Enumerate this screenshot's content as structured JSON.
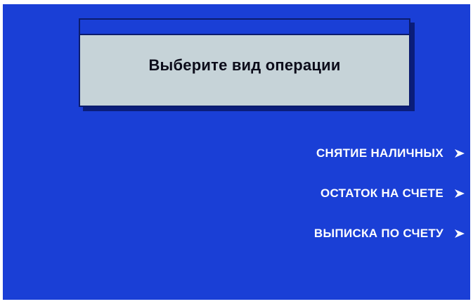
{
  "screen": {
    "prompt": "Выберите вид операции",
    "background_color": "#1a3fd6",
    "prompt_box_color": "#c6d3d8"
  },
  "menu": {
    "items": [
      {
        "label": "СНЯТИЕ НАЛИЧНЫХ",
        "icon": "chevron-right-icon"
      },
      {
        "label": "ОСТАТОК НА СЧЕТЕ",
        "icon": "chevron-right-icon"
      },
      {
        "label": "ВЫПИСКА ПО СЧЕТУ",
        "icon": "chevron-right-icon"
      }
    ]
  }
}
